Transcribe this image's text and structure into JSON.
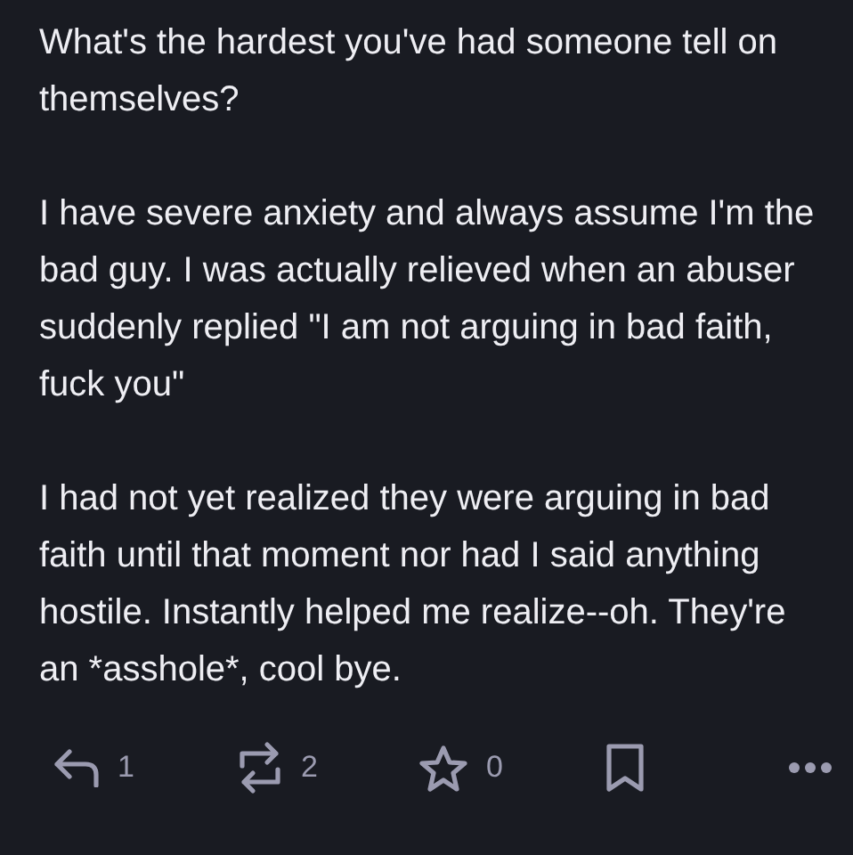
{
  "post": {
    "paragraphs": [
      "What's the hardest you've had someone tell on themselves?",
      "I have severe anxiety and always assume I'm the bad guy. I was actually relieved when an abuser suddenly replied \"I am not arguing in bad faith, fuck you\"",
      "I had not yet realized they were arguing in bad faith until that moment nor had I said anything hostile. Instantly helped me realize--oh. They're an *asshole*, cool bye."
    ]
  },
  "actions": [
    {
      "kind": "reply",
      "count": "1"
    },
    {
      "kind": "boost",
      "count": "2"
    },
    {
      "kind": "favourite",
      "count": "0"
    },
    {
      "kind": "bookmark"
    },
    {
      "kind": "more"
    }
  ]
}
